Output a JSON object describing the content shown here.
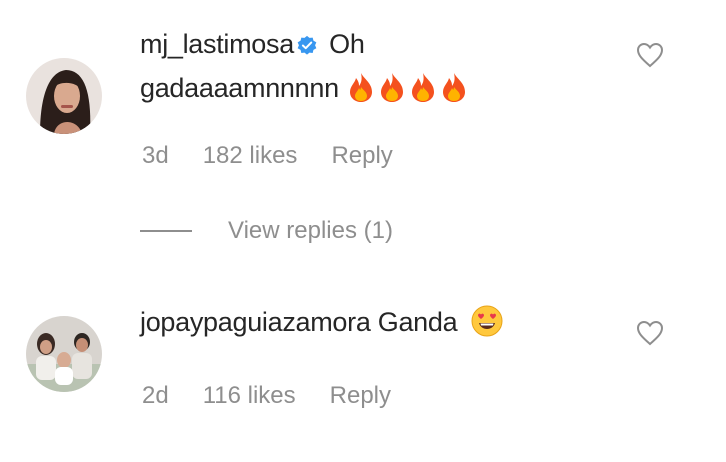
{
  "comments": [
    {
      "username": "mj_lastimosa",
      "verified": true,
      "text_line1": "Oh",
      "text_line2": "gadaaaamnnnnn",
      "emojis": [
        "fire",
        "fire",
        "fire",
        "fire"
      ],
      "time": "3d",
      "likes": "182 likes",
      "reply_label": "Reply"
    },
    {
      "username": "jopaypaguiazamora",
      "verified": false,
      "text_line1": "Ganda",
      "emojis": [
        "heart-eyes"
      ],
      "time": "2d",
      "likes": "116 likes",
      "reply_label": "Reply"
    }
  ],
  "view_replies": "View replies (1)",
  "colors": {
    "text": "#262626",
    "meta": "#8e8e8e",
    "verified": "#3897f0",
    "fire": "#f4511e",
    "emoji_face": "#ffc83d"
  }
}
